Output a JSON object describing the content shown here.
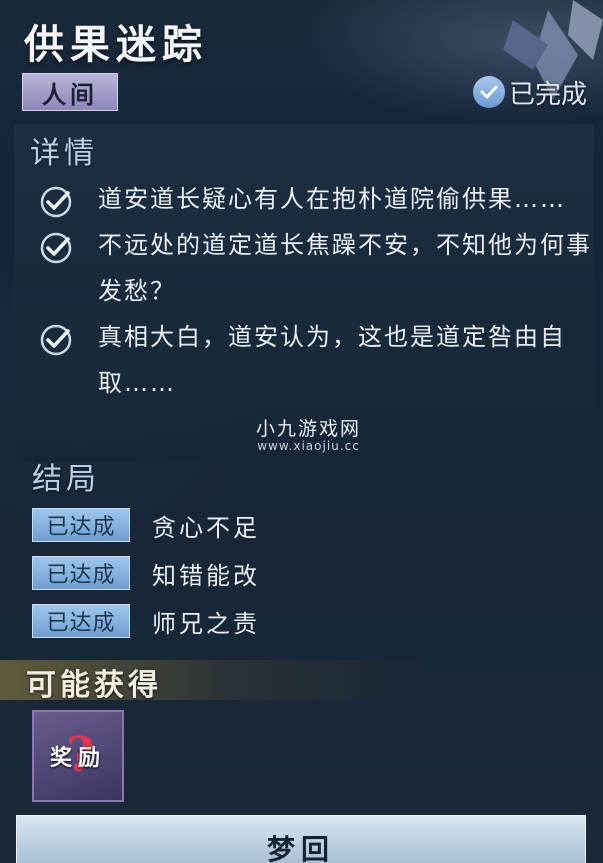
{
  "header": {
    "title": "供果迷踪",
    "realm_tag": "人间",
    "status_label": "已完成"
  },
  "details": {
    "heading": "详情",
    "items": [
      "道安道长疑心有人在抱朴道院偷供果……",
      "不远处的道定道长焦躁不安，不知他为何事发愁？",
      "真相大白，道安认为，这也是道定咎由自取……"
    ]
  },
  "watermark": {
    "main": "小九游戏网",
    "sub": "www.xiaojiu.cc"
  },
  "endings": {
    "heading": "结局",
    "badge_label": "已达成",
    "items": [
      "贪心不足",
      "知错能改",
      "师兄之责"
    ]
  },
  "rewards": {
    "heading": "可能获得",
    "card_label": "奖励"
  },
  "actions": {
    "dream_label": "梦回"
  },
  "colors": {
    "accent_blue": "#8fb8e4",
    "realm_tag": "#a59fcc",
    "reward_card": "#5a4d80"
  },
  "icons": {
    "check": "check-circle-icon",
    "reward": "question-reward-icon"
  }
}
